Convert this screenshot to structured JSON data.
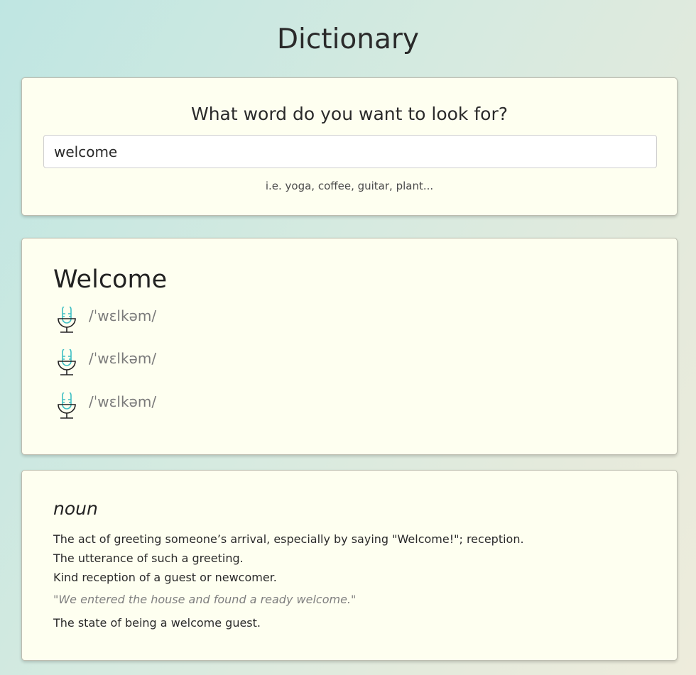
{
  "header": {
    "title": "Dictionary"
  },
  "search": {
    "prompt": "What word do you want to look for?",
    "value": "welcome",
    "hint": "i.e. yoga, coffee, guitar, plant..."
  },
  "word": {
    "heading": "Welcome",
    "phonetics": [
      {
        "text": "/ˈwɛlkəm/",
        "icon": "microphone-icon"
      },
      {
        "text": "/ˈwɛlkəm/",
        "icon": "microphone-icon"
      },
      {
        "text": "/ˈwɛlkəm/",
        "icon": "microphone-icon"
      }
    ]
  },
  "meaning": {
    "part_of_speech": "noun",
    "definitions": [
      "The act of greeting someone’s arrival, especially by saying \"Welcome!\"; reception.",
      "The utterance of such a greeting.",
      "Kind reception of a guest or newcomer.",
      "The state of being a welcome guest."
    ],
    "example": "\"We entered the house and found a ready welcome.\""
  },
  "colors": {
    "card_background": "#fefff0",
    "mic_accent": "#3fbfc4",
    "example_text": "#7f7f7f"
  }
}
